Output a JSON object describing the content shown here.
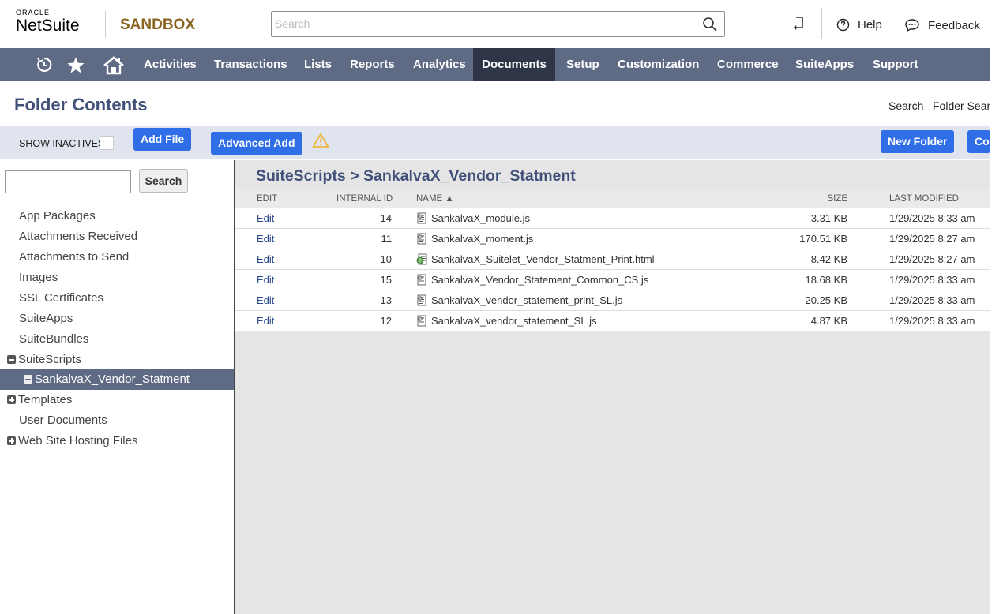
{
  "header": {
    "brand_top": "ORACLE",
    "brand_name": "NetSuite",
    "environment": "SANDBOX",
    "search_placeholder": "Search",
    "help_label": "Help",
    "feedback_label": "Feedback"
  },
  "nav": {
    "items": [
      "Activities",
      "Transactions",
      "Lists",
      "Reports",
      "Analytics",
      "Documents",
      "Setup",
      "Customization",
      "Commerce",
      "SuiteApps",
      "Support"
    ],
    "active": "Documents"
  },
  "page": {
    "title": "Folder Contents",
    "links": [
      "Search",
      "Folder Sear"
    ]
  },
  "toolbar": {
    "show_inactives_label": "SHOW INACTIVES",
    "add_file_label": "Add File",
    "advanced_add_label": "Advanced Add",
    "new_folder_label": "New Folder",
    "cut_off_button_label": "Co"
  },
  "tree": {
    "search_button_label": "Search",
    "items": [
      {
        "label": "App Packages",
        "toggle": "none",
        "level": 0
      },
      {
        "label": "Attachments Received",
        "toggle": "none",
        "level": 0
      },
      {
        "label": "Attachments to Send",
        "toggle": "none",
        "level": 0
      },
      {
        "label": "Images",
        "toggle": "none",
        "level": 0
      },
      {
        "label": "SSL Certificates",
        "toggle": "none",
        "level": 0
      },
      {
        "label": "SuiteApps",
        "toggle": "none",
        "level": 0
      },
      {
        "label": "SuiteBundles",
        "toggle": "none",
        "level": 0
      },
      {
        "label": "SuiteScripts",
        "toggle": "minus",
        "level": 0
      },
      {
        "label": "SankalvaX_Vendor_Statment",
        "toggle": "minus",
        "level": 1,
        "selected": true
      },
      {
        "label": "Templates",
        "toggle": "plus",
        "level": 0
      },
      {
        "label": "User Documents",
        "toggle": "none",
        "level": 0
      },
      {
        "label": "Web Site Hosting Files",
        "toggle": "plus",
        "level": 0
      }
    ]
  },
  "files": {
    "breadcrumb": "SuiteScripts > SankalvaX_Vendor_Statment",
    "columns": {
      "edit": "EDIT",
      "internal_id": "INTERNAL ID",
      "name": "NAME ▲",
      "size": "SIZE",
      "last_modified": "LAST MODIFIED"
    },
    "rows": [
      {
        "edit": "Edit",
        "id": "14",
        "name": "SankalvaX_module.js",
        "icon": "script-file-icon",
        "size": "3.31 KB",
        "modified": "1/29/2025 8:33 am"
      },
      {
        "edit": "Edit",
        "id": "11",
        "name": "SankalvaX_moment.js",
        "icon": "script-file-icon",
        "size": "170.51 KB",
        "modified": "1/29/2025 8:27 am"
      },
      {
        "edit": "Edit",
        "id": "10",
        "name": "SankalvaX_Suitelet_Vendor_Statment_Print.html",
        "icon": "html-file-icon",
        "size": "8.42 KB",
        "modified": "1/29/2025 8:27 am"
      },
      {
        "edit": "Edit",
        "id": "15",
        "name": "SankalvaX_Vendor_Statement_Common_CS.js",
        "icon": "script-file-icon",
        "size": "18.68 KB",
        "modified": "1/29/2025 8:33 am"
      },
      {
        "edit": "Edit",
        "id": "13",
        "name": "SankalvaX_vendor_statement_print_SL.js",
        "icon": "script-file-icon",
        "size": "20.25 KB",
        "modified": "1/29/2025 8:33 am"
      },
      {
        "edit": "Edit",
        "id": "12",
        "name": "SankalvaX_vendor_statement_SL.js",
        "icon": "script-file-icon",
        "size": "4.87 KB",
        "modified": "1/29/2025 8:33 am"
      }
    ]
  },
  "colors": {
    "nav_bg": "#5f6b85",
    "nav_active": "#2f3648",
    "accent_blue": "#2f6ee6",
    "title_blue": "#415079",
    "sandbox_gold": "#8a6420"
  }
}
